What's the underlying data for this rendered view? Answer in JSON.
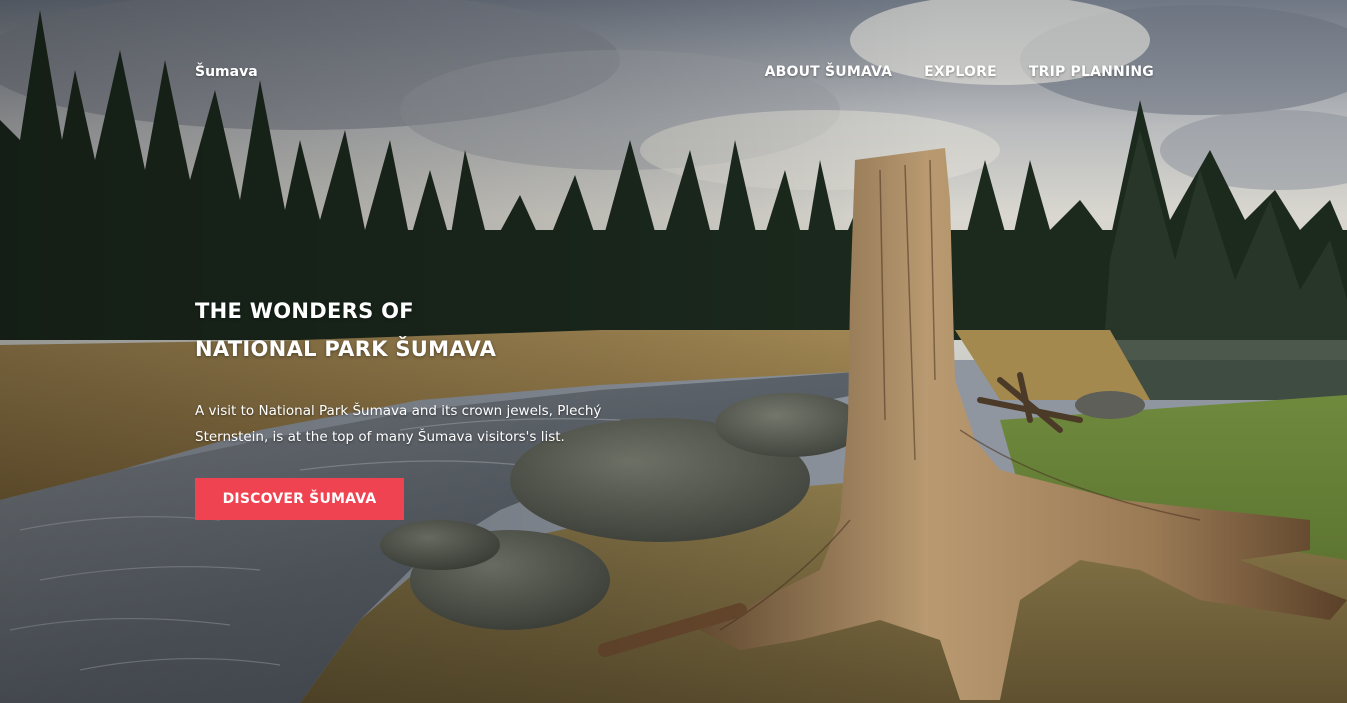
{
  "brand": {
    "name": "Šumava"
  },
  "nav": {
    "items": [
      {
        "label": "ABOUT ŠUMAVA"
      },
      {
        "label": "EXPLORE"
      },
      {
        "label": "TRIP PLANNING"
      }
    ]
  },
  "hero": {
    "title_line1": "THE WONDERS OF",
    "title_line2": "NATIONAL PARK ŠUMAVA",
    "lead": "A visit to National Park Šumava and its crown jewels, Plechý Sternstein, is at the top of many Šumava visitors's list.",
    "cta_label": "DISCOVER ŠUMAVA",
    "background_image": "forest-river-landscape"
  },
  "colors": {
    "accent": "#ef4352",
    "text": "#ffffff"
  }
}
